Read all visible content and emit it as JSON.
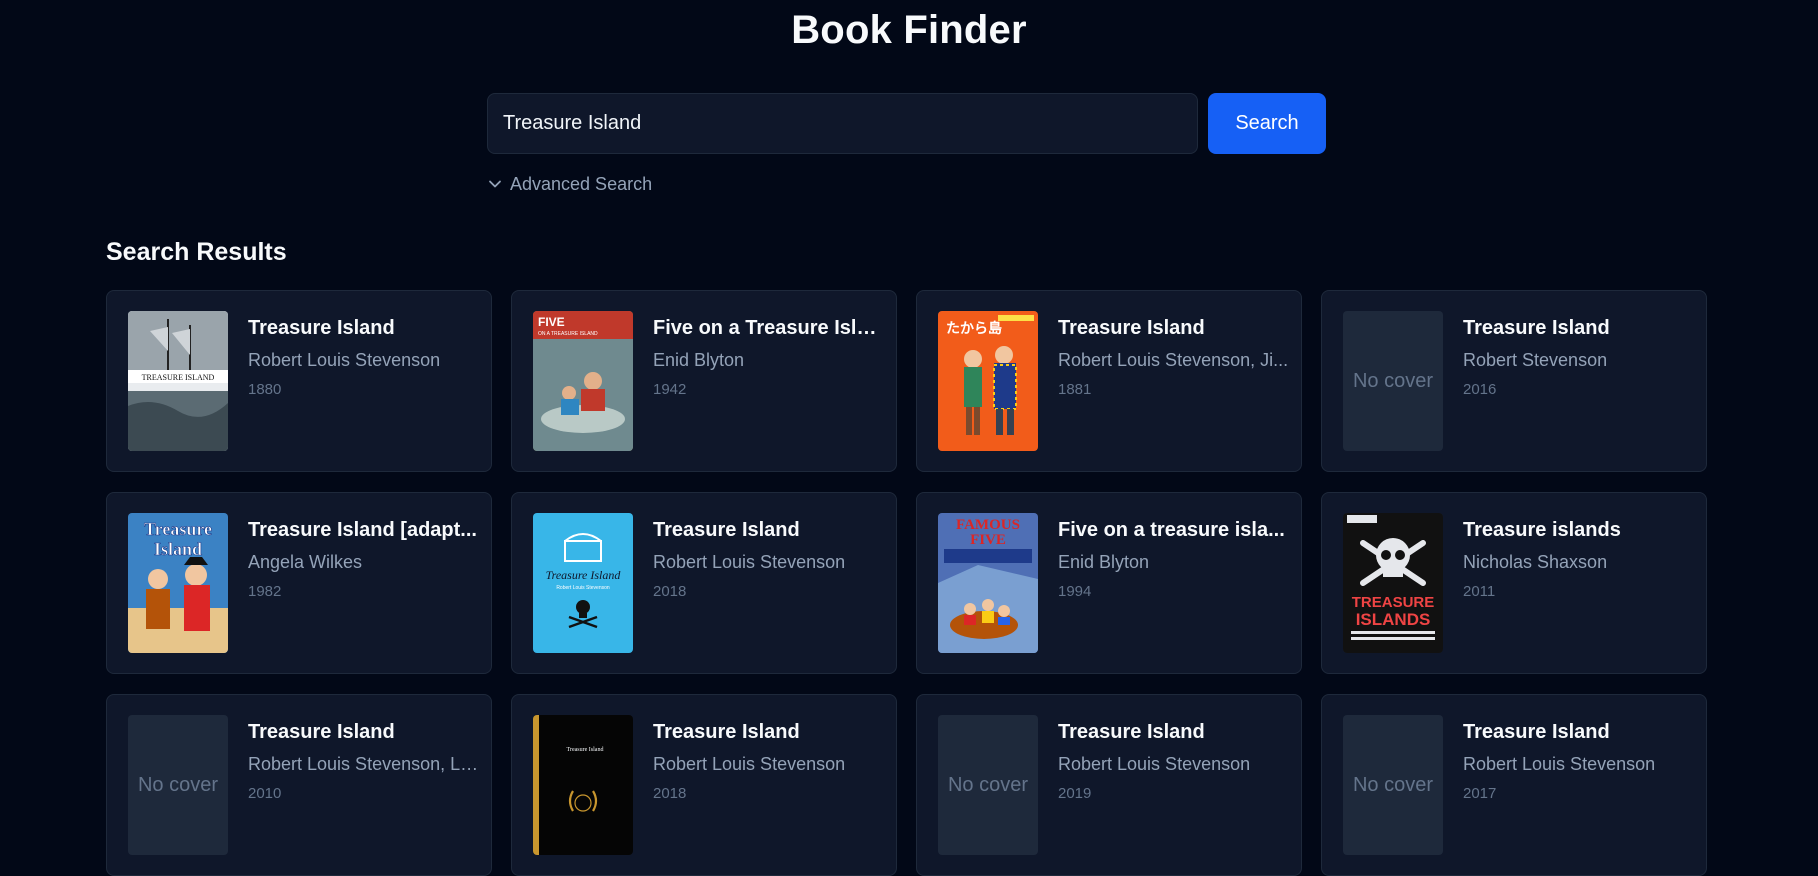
{
  "app": {
    "title": "Book Finder"
  },
  "search": {
    "value": "Treasure Island",
    "button_label": "Search",
    "advanced_label": "Advanced Search"
  },
  "results": {
    "heading": "Search Results",
    "no_cover_label": "No cover",
    "books": [
      {
        "title": "Treasure Island",
        "author": "Robert Louis Stevenson",
        "year": "1880",
        "cover": "ship-cover",
        "cover_text": "TREASURE ISLAND"
      },
      {
        "title": "Five on a Treasure Island",
        "author": "Enid Blyton",
        "year": "1942",
        "cover": "five-cover",
        "cover_text": "FIVE",
        "cover_subtext": "ON A TREASURE ISLAND"
      },
      {
        "title": "Treasure Island",
        "author": "Robert Louis Stevenson, Ji...",
        "year": "1881",
        "cover": "japanese-cover",
        "cover_text": "たから島"
      },
      {
        "title": "Treasure Island",
        "author": "Robert Stevenson",
        "year": "2016",
        "cover": "none"
      },
      {
        "title": "Treasure Island [adapt...",
        "author": "Angela Wilkes",
        "year": "1982",
        "cover": "pirates-cover",
        "cover_text": "Treasure",
        "cover_subtext": "Island"
      },
      {
        "title": "Treasure Island",
        "author": "Robert Louis Stevenson",
        "year": "2018",
        "cover": "blue-chest-cover",
        "cover_text": "Treasure Island",
        "cover_subtext": "Robert Louis Stevenson"
      },
      {
        "title": "Five on a treasure isla...",
        "author": "Enid Blyton",
        "year": "1994",
        "cover": "famous-five-cover",
        "cover_text": "FAMOUS",
        "cover_subtext": "FIVE"
      },
      {
        "title": "Treasure islands",
        "author": "Nicholas Shaxson",
        "year": "2011",
        "cover": "skull-cover",
        "cover_text": "TREASURE",
        "cover_subtext": "ISLANDS"
      },
      {
        "title": "Treasure Island",
        "author": "Robert Louis Stevenson, Lo...",
        "year": "2010",
        "cover": "none"
      },
      {
        "title": "Treasure Island",
        "author": "Robert Louis Stevenson",
        "year": "2018",
        "cover": "black-gold-cover",
        "cover_text": "Treasure Island"
      },
      {
        "title": "Treasure Island",
        "author": "Robert Louis Stevenson",
        "year": "2019",
        "cover": "none"
      },
      {
        "title": "Treasure Island",
        "author": "Robert Louis Stevenson",
        "year": "2017",
        "cover": "none"
      }
    ]
  },
  "colors": {
    "background": "#020817",
    "card": "#0f172a",
    "accent": "#1660f5",
    "muted_text": "#94a3b8"
  }
}
